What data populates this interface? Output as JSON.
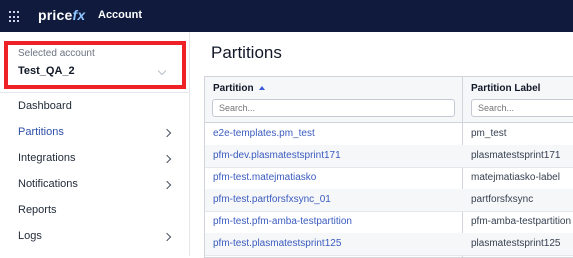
{
  "topbar": {
    "logo_main": "price",
    "logo_accent": "fx",
    "app_title": "Account"
  },
  "account": {
    "label": "Selected account",
    "value": "Test_QA_2"
  },
  "sidebar": {
    "items": [
      {
        "label": "Dashboard"
      },
      {
        "label": "Partitions"
      },
      {
        "label": "Integrations"
      },
      {
        "label": "Notifications"
      },
      {
        "label": "Reports"
      },
      {
        "label": "Logs"
      }
    ]
  },
  "main": {
    "title": "Partitions",
    "table": {
      "columns": [
        {
          "label": "Partition",
          "search_placeholder": "Search..."
        },
        {
          "label": "Partition Label",
          "search_placeholder": "Search..."
        }
      ],
      "rows": [
        {
          "partition": "e2e-templates.pm_test",
          "label": "pm_test"
        },
        {
          "partition": "pfm-dev.plasmatestsprint171",
          "label": "plasmatestsprint171"
        },
        {
          "partition": "pfm-test.matejmatiasko",
          "label": "matejmatiasko-label"
        },
        {
          "partition": "pfm-test.partforsfxsync_01",
          "label": "partforsfxsync"
        },
        {
          "partition": "pfm-test.pfm-amba-testpartition",
          "label": "pfm-amba-testpartition"
        },
        {
          "partition": "pfm-test.plasmatestsprint125",
          "label": "plasmatestsprint125"
        }
      ]
    }
  }
}
